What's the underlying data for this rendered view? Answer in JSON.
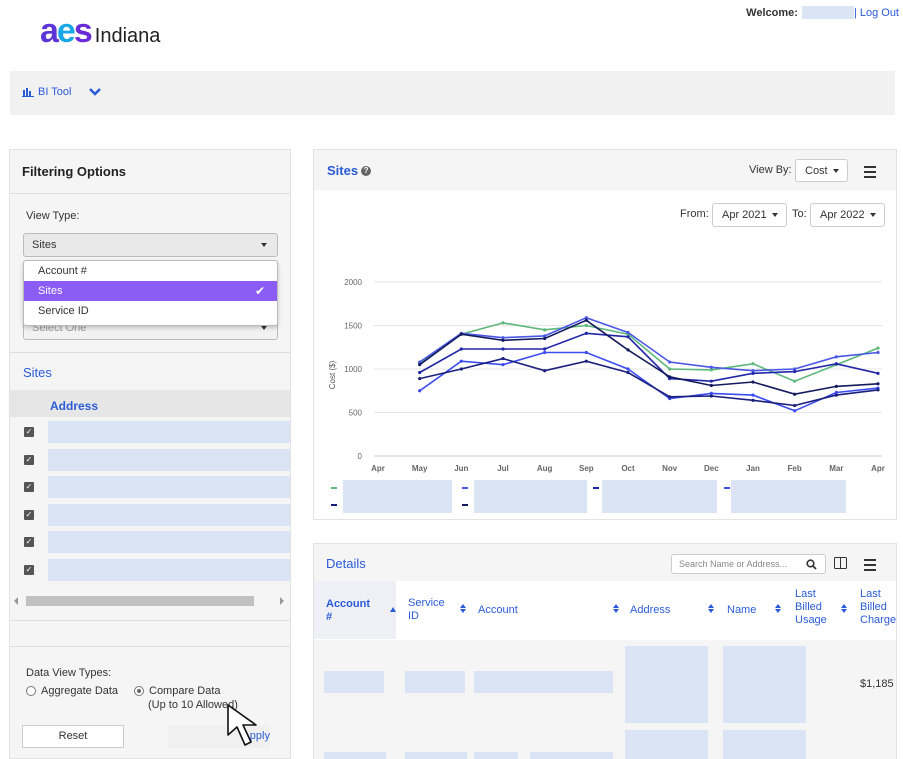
{
  "header": {
    "logo_text": "aes",
    "brand_suffix": "Indiana",
    "welcome_label": "Welcome:",
    "logout_label": "| Log Out"
  },
  "toolbar": {
    "app_name": "BI Tool"
  },
  "filters": {
    "title": "Filtering Options",
    "view_type_label": "View Type:",
    "view_type_value": "Sites",
    "view_type_options": [
      "Account #",
      "Sites",
      "Service ID"
    ],
    "secondary_select_placeholder": "Select One",
    "sites_title": "Sites",
    "address_header": "Address",
    "site_rows": 6,
    "data_view_types_label": "Data View Types:",
    "aggregate_label": "Aggregate Data",
    "compare_label": "Compare Data",
    "compare_note": "(Up to 10 Allowed)",
    "reset_label": "Reset",
    "apply_label": "Apply"
  },
  "chart_panel": {
    "title": "Sites",
    "view_by_label": "View By:",
    "view_by_value": "Cost",
    "from_label": "From:",
    "from_value": "Apr 2021",
    "to_label": "To:",
    "to_value": "Apr 2022"
  },
  "chart_data": {
    "type": "line",
    "x": [
      "Apr",
      "May",
      "Jun",
      "Jul",
      "Aug",
      "Sep",
      "Oct",
      "Nov",
      "Dec",
      "Jan",
      "Feb",
      "Mar",
      "Apr"
    ],
    "ylabel": "Cost ($)",
    "ylim": [
      0,
      2000
    ],
    "yticks": [
      0,
      500,
      1000,
      1500,
      2000
    ],
    "grid": true,
    "legend_position": "bottom",
    "series": [
      {
        "color": "#5cb87a",
        "values": [
          null,
          1070,
          1400,
          1530,
          1450,
          1500,
          1400,
          1000,
          990,
          1060,
          860,
          1050,
          1240
        ]
      },
      {
        "color": "#4a57e6",
        "values": [
          null,
          1080,
          1410,
          1360,
          1380,
          1590,
          1420,
          1080,
          1020,
          980,
          1000,
          1140,
          1190
        ]
      },
      {
        "color": "#2226a8",
        "values": [
          null,
          960,
          1230,
          1230,
          1230,
          1410,
          1370,
          890,
          860,
          950,
          970,
          1060,
          950
        ]
      },
      {
        "color": "#3c4cf0",
        "values": [
          null,
          750,
          1090,
          1050,
          1190,
          1190,
          1000,
          660,
          720,
          700,
          520,
          730,
          780
        ]
      },
      {
        "color": "#1b1f7c",
        "values": [
          null,
          890,
          1000,
          1120,
          980,
          1090,
          960,
          680,
          690,
          640,
          580,
          700,
          760
        ]
      },
      {
        "color": "#141a5e",
        "values": [
          null,
          1050,
          1400,
          1330,
          1350,
          1560,
          1220,
          910,
          810,
          850,
          710,
          800,
          830
        ]
      }
    ]
  },
  "details": {
    "title": "Details",
    "search_placeholder": "Search Name or Address...",
    "columns": [
      "Account #",
      "Service ID",
      "Account",
      "Address",
      "Name",
      "Last Billed Usage",
      "Last Billed Charge"
    ],
    "first_row_charge": "$1,185"
  }
}
